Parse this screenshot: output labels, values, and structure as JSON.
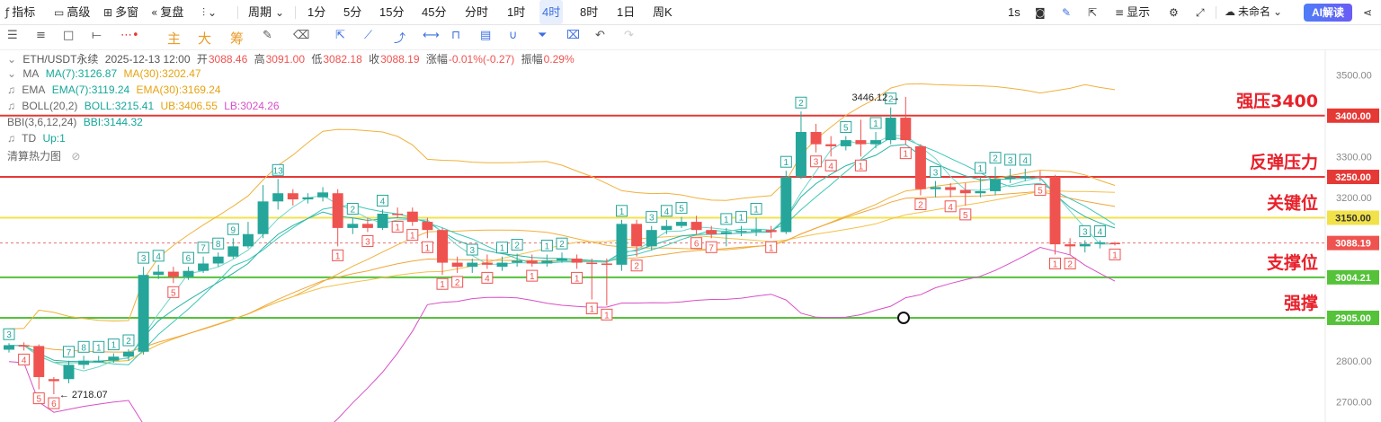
{
  "toolbar": {
    "indicator": "指标",
    "advanced": "高级",
    "multi_window": "多窗",
    "replay": "复盘",
    "period": "周期",
    "intervals": [
      "1分",
      "5分",
      "15分",
      "45分",
      "分时",
      "1时",
      "4时",
      "8时",
      "1日",
      "周K"
    ],
    "active_interval": "4时",
    "one_s": "1s",
    "display": "显示",
    "unnamed": "未命名",
    "ai": "AI解读"
  },
  "drawing_toolbar": {
    "main": "主",
    "large": "大",
    "accumulate": "筹"
  },
  "legend": {
    "symbol": "ETH/USDT永续",
    "datetime": "2025-12-13 12:00",
    "open_label": "开",
    "open": "3088.46",
    "high_label": "高",
    "high": "3091.00",
    "low_label": "低",
    "low": "3082.18",
    "close_label": "收",
    "close": "3088.19",
    "change_label": "涨幅",
    "change": "-0.01%(-0.27)",
    "amp_label": "振幅",
    "amp": "0.29%",
    "ma_name": "MA",
    "ma7": "MA(7):3126.87",
    "ma30": "MA(30):3202.47",
    "ema_name": "EMA",
    "ema7": "EMA(7):3119.24",
    "ema30": "EMA(30):3169.24",
    "boll_name": "BOLL(20,2)",
    "boll": "BOLL:3215.41",
    "ub": "UB:3406.55",
    "lb": "LB:3024.26",
    "bbi_name": "BBI(3,6,12,24)",
    "bbi": "BBI:3144.32",
    "td_name": "TD",
    "td_up": "Up:1",
    "heatmap": "清算热力图"
  },
  "colors": {
    "up": "#26a69a",
    "down": "#ef5350",
    "red_line": "#e53935",
    "yellow_line": "#f2e24a",
    "green_line": "#55c23a",
    "boll": "#f0b13c",
    "lb": "#d94fc7",
    "teal": "#3cc7b8",
    "annotation": "#e8202a"
  },
  "price_axis": {
    "ticks": [
      "3500.00",
      "3300.00",
      "3200.00",
      "2800.00",
      "2700.00"
    ],
    "tick_values": [
      3500,
      3300,
      3200,
      2800,
      2700
    ],
    "y_range": [
      2650,
      3560
    ]
  },
  "levels": [
    {
      "value": 3400,
      "tag": "3400.00",
      "label": "强压3400",
      "color": "#e53935",
      "tag_bg": "#e53935"
    },
    {
      "value": 3250,
      "tag": "3250.00",
      "label": "反弹压力",
      "color": "#e53935",
      "tag_bg": "#e53935"
    },
    {
      "value": 3150,
      "tag": "3150.00",
      "label": "关键位",
      "color": "#f2e24a",
      "tag_bg": "#f2e24a"
    },
    {
      "value": 3004.21,
      "tag": "3004.21",
      "label": "支撑位",
      "color": "#55c23a",
      "tag_bg": "#55c23a"
    },
    {
      "value": 2905,
      "tag": "2905.00",
      "label": "强撑",
      "color": "#55c23a",
      "tag_bg": "#55c23a"
    }
  ],
  "last_price": {
    "value": 3088.19,
    "tag": "3088.19"
  },
  "extremes": {
    "high": "3446.12",
    "low": "2718.07"
  },
  "candles": [
    {
      "o": 2827,
      "c": 2838,
      "h": 2843,
      "l": 2820,
      "td": "3"
    },
    {
      "o": 2838,
      "c": 2836,
      "h": 2845,
      "l": 2825,
      "td": "4"
    },
    {
      "o": 2836,
      "c": 2760,
      "h": 2840,
      "l": 2730,
      "td": "5"
    },
    {
      "o": 2755,
      "c": 2750,
      "h": 2760,
      "l": 2718,
      "td": "6"
    },
    {
      "o": 2755,
      "c": 2790,
      "h": 2800,
      "l": 2745,
      "td": "7"
    },
    {
      "o": 2790,
      "c": 2800,
      "h": 2812,
      "l": 2780,
      "td": "8"
    },
    {
      "o": 2800,
      "c": 2800,
      "h": 2812,
      "l": 2795,
      "td": "1"
    },
    {
      "o": 2800,
      "c": 2810,
      "h": 2818,
      "l": 2795,
      "td": "1"
    },
    {
      "o": 2810,
      "c": 2822,
      "h": 2828,
      "l": 2800,
      "td": "2"
    },
    {
      "o": 2822,
      "c": 3010,
      "h": 3030,
      "l": 2815,
      "td": "3"
    },
    {
      "o": 3010,
      "c": 3018,
      "h": 3035,
      "l": 3000,
      "td": "4"
    },
    {
      "o": 3018,
      "c": 3005,
      "h": 3030,
      "l": 2990,
      "td": "5"
    },
    {
      "o": 3005,
      "c": 3020,
      "h": 3030,
      "l": 2998,
      "td": "6"
    },
    {
      "o": 3020,
      "c": 3038,
      "h": 3055,
      "l": 3015,
      "td": "7"
    },
    {
      "o": 3038,
      "c": 3055,
      "h": 3065,
      "l": 3030,
      "td": "8"
    },
    {
      "o": 3055,
      "c": 3080,
      "h": 3100,
      "l": 3050,
      "td": "9"
    },
    {
      "o": 3080,
      "c": 3110,
      "h": 3140,
      "l": 3075,
      "td": ""
    },
    {
      "o": 3110,
      "c": 3190,
      "h": 3230,
      "l": 3100,
      "td": ""
    },
    {
      "o": 3190,
      "c": 3210,
      "h": 3245,
      "l": 3170,
      "td": "13"
    },
    {
      "o": 3210,
      "c": 3195,
      "h": 3220,
      "l": 3180,
      "td": ""
    },
    {
      "o": 3195,
      "c": 3200,
      "h": 3210,
      "l": 3185,
      "td": ""
    },
    {
      "o": 3200,
      "c": 3212,
      "h": 3225,
      "l": 3190,
      "td": ""
    },
    {
      "o": 3210,
      "c": 3125,
      "h": 3220,
      "l": 3080,
      "td": "1"
    },
    {
      "o": 3125,
      "c": 3135,
      "h": 3150,
      "l": 3110,
      "td": "2"
    },
    {
      "o": 3135,
      "c": 3125,
      "h": 3150,
      "l": 3115,
      "td": "3"
    },
    {
      "o": 3125,
      "c": 3160,
      "h": 3170,
      "l": 3120,
      "td": "4"
    },
    {
      "o": 3160,
      "c": 3158,
      "h": 3175,
      "l": 3150,
      "td": "1"
    },
    {
      "o": 3165,
      "c": 3140,
      "h": 3175,
      "l": 3130,
      "td": "1"
    },
    {
      "o": 3140,
      "c": 3120,
      "h": 3150,
      "l": 3100,
      "td": "1"
    },
    {
      "o": 3120,
      "c": 3040,
      "h": 3125,
      "l": 3010,
      "td": "1"
    },
    {
      "o": 3040,
      "c": 3030,
      "h": 3055,
      "l": 3015,
      "td": "2"
    },
    {
      "o": 3030,
      "c": 3040,
      "h": 3050,
      "l": 3015,
      "td": "3"
    },
    {
      "o": 3040,
      "c": 3035,
      "h": 3060,
      "l": 3025,
      "td": "4"
    },
    {
      "o": 3030,
      "c": 3040,
      "h": 3055,
      "l": 3020,
      "td": "1"
    },
    {
      "o": 3040,
      "c": 3045,
      "h": 3062,
      "l": 3030,
      "td": "2"
    },
    {
      "o": 3045,
      "c": 3038,
      "h": 3060,
      "l": 3030,
      "td": "1"
    },
    {
      "o": 3038,
      "c": 3045,
      "h": 3060,
      "l": 3030,
      "td": "1"
    },
    {
      "o": 3045,
      "c": 3050,
      "h": 3065,
      "l": 3040,
      "td": "2"
    },
    {
      "o": 3050,
      "c": 3040,
      "h": 3060,
      "l": 3025,
      "td": "1"
    },
    {
      "o": 3040,
      "c": 3038,
      "h": 3050,
      "l": 2950,
      "td": "1"
    },
    {
      "o": 3038,
      "c": 3035,
      "h": 3050,
      "l": 2935,
      "td": "1"
    },
    {
      "o": 3035,
      "c": 3135,
      "h": 3145,
      "l": 3020,
      "td": "1"
    },
    {
      "o": 3135,
      "c": 3080,
      "h": 3145,
      "l": 3055,
      "td": "2"
    },
    {
      "o": 3080,
      "c": 3120,
      "h": 3130,
      "l": 3070,
      "td": "3"
    },
    {
      "o": 3120,
      "c": 3130,
      "h": 3145,
      "l": 3110,
      "td": "4"
    },
    {
      "o": 3130,
      "c": 3140,
      "h": 3152,
      "l": 3125,
      "td": "5"
    },
    {
      "o": 3140,
      "c": 3120,
      "h": 3155,
      "l": 3110,
      "td": "6"
    },
    {
      "o": 3120,
      "c": 3110,
      "h": 3130,
      "l": 3100,
      "td": "7"
    },
    {
      "o": 3110,
      "c": 3115,
      "h": 3125,
      "l": 3080,
      "td": "1"
    },
    {
      "o": 3115,
      "c": 3118,
      "h": 3130,
      "l": 3105,
      "td": "1"
    },
    {
      "o": 3118,
      "c": 3120,
      "h": 3150,
      "l": 3105,
      "td": "1"
    },
    {
      "o": 3120,
      "c": 3115,
      "h": 3130,
      "l": 3100,
      "td": "1"
    },
    {
      "o": 3115,
      "c": 3250,
      "h": 3265,
      "l": 3110,
      "td": "1"
    },
    {
      "o": 3250,
      "c": 3360,
      "h": 3410,
      "l": 3245,
      "td": "2"
    },
    {
      "o": 3360,
      "c": 3330,
      "h": 3380,
      "l": 3310,
      "td": "3"
    },
    {
      "o": 3330,
      "c": 3325,
      "h": 3350,
      "l": 3300,
      "td": "4"
    },
    {
      "o": 3325,
      "c": 3340,
      "h": 3350,
      "l": 3315,
      "td": "5"
    },
    {
      "o": 3340,
      "c": 3330,
      "h": 3390,
      "l": 3300,
      "td": "1"
    },
    {
      "o": 3330,
      "c": 3340,
      "h": 3360,
      "l": 3320,
      "td": "1"
    },
    {
      "o": 3340,
      "c": 3395,
      "h": 3420,
      "l": 3330,
      "td": "2"
    },
    {
      "o": 3395,
      "c": 3340,
      "h": 3446,
      "l": 3330,
      "td": "1"
    },
    {
      "o": 3325,
      "c": 3220,
      "h": 3330,
      "l": 3205,
      "td": "2"
    },
    {
      "o": 3220,
      "c": 3225,
      "h": 3240,
      "l": 3200,
      "td": "3"
    },
    {
      "o": 3225,
      "c": 3218,
      "h": 3235,
      "l": 3200,
      "td": "4"
    },
    {
      "o": 3218,
      "c": 3210,
      "h": 3235,
      "l": 3180,
      "td": "5"
    },
    {
      "o": 3210,
      "c": 3215,
      "h": 3250,
      "l": 3200,
      "td": "1"
    },
    {
      "o": 3215,
      "c": 3245,
      "h": 3275,
      "l": 3205,
      "td": "2"
    },
    {
      "o": 3245,
      "c": 3250,
      "h": 3270,
      "l": 3235,
      "td": "3"
    },
    {
      "o": 3250,
      "c": 3252,
      "h": 3270,
      "l": 3240,
      "td": "4"
    },
    {
      "o": 3252,
      "c": 3250,
      "h": 3265,
      "l": 3240,
      "td": "5"
    },
    {
      "o": 3250,
      "c": 3085,
      "h": 3255,
      "l": 3060,
      "td": "1"
    },
    {
      "o": 3085,
      "c": 3080,
      "h": 3100,
      "l": 3060,
      "td": "2"
    },
    {
      "o": 3080,
      "c": 3086,
      "h": 3095,
      "l": 3065,
      "td": "3"
    },
    {
      "o": 3086,
      "c": 3090,
      "h": 3095,
      "l": 3075,
      "td": "4"
    },
    {
      "o": 3088.46,
      "c": 3088.19,
      "h": 3091,
      "l": 3082.18,
      "td": "1"
    }
  ]
}
